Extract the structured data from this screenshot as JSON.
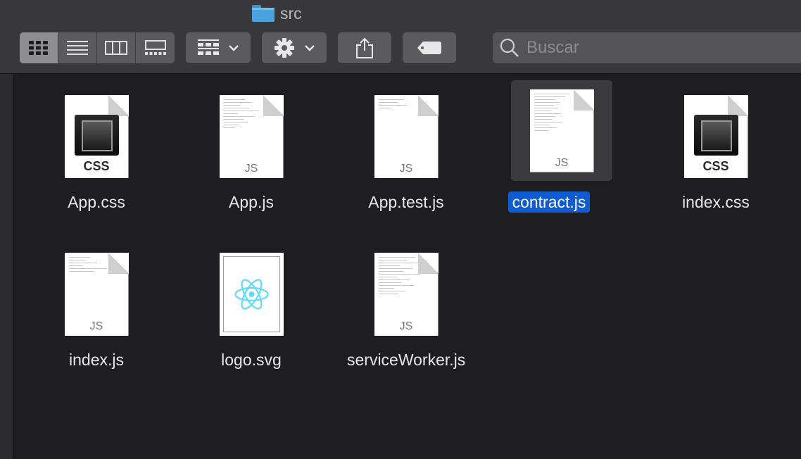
{
  "window": {
    "title": "src",
    "folder_icon": "folder-icon"
  },
  "toolbar": {
    "view_modes": [
      "icon-view",
      "list-view",
      "column-view",
      "gallery-view"
    ],
    "active_view": "icon-view",
    "group_icon": "group-by-icon",
    "action_icon": "gear-icon",
    "share_icon": "share-icon",
    "tags_icon": "tag-icon"
  },
  "search": {
    "placeholder": "Buscar"
  },
  "files": [
    {
      "name": "App.css",
      "kind": "css",
      "selected": false
    },
    {
      "name": "App.js",
      "kind": "js",
      "selected": false
    },
    {
      "name": "App.test.js",
      "kind": "js",
      "selected": false
    },
    {
      "name": "contract.js",
      "kind": "js",
      "selected": true
    },
    {
      "name": "index.css",
      "kind": "css",
      "selected": false
    },
    {
      "name": "index.js",
      "kind": "js",
      "selected": false
    },
    {
      "name": "logo.svg",
      "kind": "svg",
      "selected": false
    },
    {
      "name": "serviceWorker.js",
      "kind": "js",
      "selected": false
    }
  ],
  "ext_labels": {
    "css": "CSS",
    "js": "JS"
  },
  "colors": {
    "selection": "#0f5bd1",
    "react_logo": "#61dafb",
    "folder": "#4aa3df"
  }
}
